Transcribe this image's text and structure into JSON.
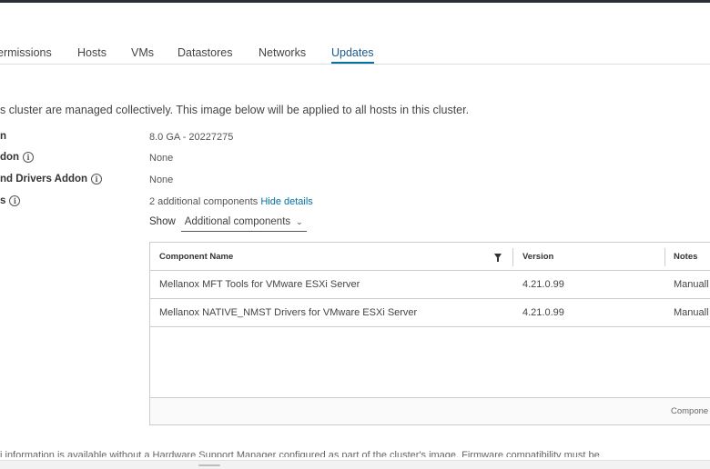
{
  "tabs": [
    {
      "label": "ermissions",
      "active": false
    },
    {
      "label": "Hosts",
      "active": false
    },
    {
      "label": "VMs",
      "active": false
    },
    {
      "label": "Datastores",
      "active": false
    },
    {
      "label": "Networks",
      "active": false
    },
    {
      "label": "Updates",
      "active": true
    }
  ],
  "intro_text": "s cluster are managed collectively. This image below will be applied to all hosts in this cluster.",
  "fields": {
    "version": {
      "label": "n",
      "value": "8.0 GA - 20227275"
    },
    "vendor_addon": {
      "label": "don",
      "value": "None"
    },
    "firmware_addon": {
      "label": "nd Drivers Addon",
      "value": "None"
    },
    "components": {
      "label": "s",
      "value": "2 additional components",
      "link": "Hide details"
    }
  },
  "show": {
    "label": "Show",
    "selected": "Additional components"
  },
  "grid": {
    "columns": [
      "Component Name",
      "Version",
      "Notes"
    ],
    "rows": [
      {
        "name": "Mellanox MFT Tools for VMware ESXi Server",
        "version": "4.21.0.99",
        "notes": "Manuall"
      },
      {
        "name": "Mellanox NATIVE_NMST Drivers for VMware ESXi Server",
        "version": "4.21.0.99",
        "notes": "Manuall"
      }
    ],
    "footer": "Compone"
  },
  "bottom_text": "i information is available without a Hardware Support Manager configured as part of the cluster's image. Firmware compatibility must be",
  "icons": {
    "info": "info-icon",
    "filter": "filter-icon",
    "chevron": "chevron-down-icon"
  },
  "colors": {
    "accent": "#0072a3",
    "topbar": "#2a2f36"
  }
}
